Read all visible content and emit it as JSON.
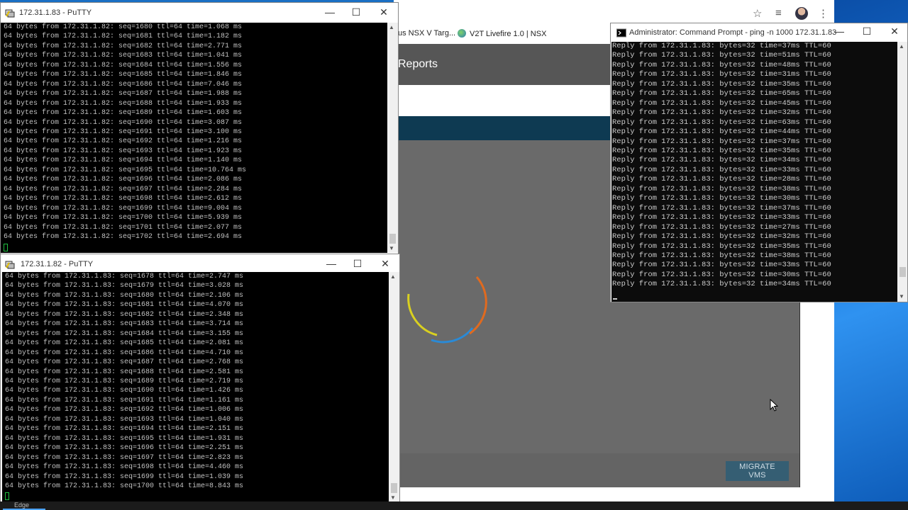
{
  "putty_top": {
    "title": "172.31.1.83 - PuTTY",
    "lines": [
      "64 bytes from 172.31.1.82: seq=1680 ttl=64 time=1.068 ms",
      "64 bytes from 172.31.1.82: seq=1681 ttl=64 time=1.182 ms",
      "64 bytes from 172.31.1.82: seq=1682 ttl=64 time=2.771 ms",
      "64 bytes from 172.31.1.82: seq=1683 ttl=64 time=1.041 ms",
      "64 bytes from 172.31.1.82: seq=1684 ttl=64 time=1.556 ms",
      "64 bytes from 172.31.1.82: seq=1685 ttl=64 time=1.846 ms",
      "64 bytes from 172.31.1.82: seq=1686 ttl=64 time=7.046 ms",
      "64 bytes from 172.31.1.82: seq=1687 ttl=64 time=1.988 ms",
      "64 bytes from 172.31.1.82: seq=1688 ttl=64 time=1.933 ms",
      "64 bytes from 172.31.1.82: seq=1689 ttl=64 time=1.603 ms",
      "64 bytes from 172.31.1.82: seq=1690 ttl=64 time=3.087 ms",
      "64 bytes from 172.31.1.82: seq=1691 ttl=64 time=3.100 ms",
      "64 bytes from 172.31.1.82: seq=1692 ttl=64 time=1.216 ms",
      "64 bytes from 172.31.1.82: seq=1693 ttl=64 time=1.923 ms",
      "64 bytes from 172.31.1.82: seq=1694 ttl=64 time=1.140 ms",
      "64 bytes from 172.31.1.82: seq=1695 ttl=64 time=10.764 ms",
      "64 bytes from 172.31.1.82: seq=1696 ttl=64 time=2.086 ms",
      "64 bytes from 172.31.1.82: seq=1697 ttl=64 time=2.284 ms",
      "64 bytes from 172.31.1.82: seq=1698 ttl=64 time=2.612 ms",
      "64 bytes from 172.31.1.82: seq=1699 ttl=64 time=9.004 ms",
      "64 bytes from 172.31.1.82: seq=1700 ttl=64 time=5.939 ms",
      "64 bytes from 172.31.1.82: seq=1701 ttl=64 time=2.077 ms",
      "64 bytes from 172.31.1.82: seq=1702 ttl=64 time=2.694 ms"
    ]
  },
  "putty_bottom": {
    "title": "172.31.1.82 - PuTTY",
    "lines": [
      "64 bytes from 172.31.1.83: seq=1678 ttl=64 time=2.747 ms",
      "64 bytes from 172.31.1.83: seq=1679 ttl=64 time=3.028 ms",
      "64 bytes from 172.31.1.83: seq=1680 ttl=64 time=2.106 ms",
      "64 bytes from 172.31.1.83: seq=1681 ttl=64 time=4.070 ms",
      "64 bytes from 172.31.1.83: seq=1682 ttl=64 time=2.348 ms",
      "64 bytes from 172.31.1.83: seq=1683 ttl=64 time=3.714 ms",
      "64 bytes from 172.31.1.83: seq=1684 ttl=64 time=3.155 ms",
      "64 bytes from 172.31.1.83: seq=1685 ttl=64 time=2.081 ms",
      "64 bytes from 172.31.1.83: seq=1686 ttl=64 time=4.710 ms",
      "64 bytes from 172.31.1.83: seq=1687 ttl=64 time=2.768 ms",
      "64 bytes from 172.31.1.83: seq=1688 ttl=64 time=2.581 ms",
      "64 bytes from 172.31.1.83: seq=1689 ttl=64 time=2.719 ms",
      "64 bytes from 172.31.1.83: seq=1690 ttl=64 time=1.426 ms",
      "64 bytes from 172.31.1.83: seq=1691 ttl=64 time=1.161 ms",
      "64 bytes from 172.31.1.83: seq=1692 ttl=64 time=1.006 ms",
      "64 bytes from 172.31.1.83: seq=1693 ttl=64 time=1.040 ms",
      "64 bytes from 172.31.1.83: seq=1694 ttl=64 time=2.151 ms",
      "64 bytes from 172.31.1.83: seq=1695 ttl=64 time=1.931 ms",
      "64 bytes from 172.31.1.83: seq=1696 ttl=64 time=2.251 ms",
      "64 bytes from 172.31.1.83: seq=1697 ttl=64 time=2.823 ms",
      "64 bytes from 172.31.1.83: seq=1698 ttl=64 time=4.460 ms",
      "64 bytes from 172.31.1.83: seq=1699 ttl=64 time=1.039 ms",
      "64 bytes from 172.31.1.83: seq=1700 ttl=64 time=8.843 ms"
    ]
  },
  "cmd": {
    "title": "Administrator: Command Prompt - ping  -n 1000 172.31.1.83",
    "lines": [
      "Reply from 172.31.1.83: bytes=32 time=37ms TTL=60",
      "Reply from 172.31.1.83: bytes=32 time=51ms TTL=60",
      "Reply from 172.31.1.83: bytes=32 time=48ms TTL=60",
      "Reply from 172.31.1.83: bytes=32 time=31ms TTL=60",
      "Reply from 172.31.1.83: bytes=32 time=35ms TTL=60",
      "Reply from 172.31.1.83: bytes=32 time=65ms TTL=60",
      "Reply from 172.31.1.83: bytes=32 time=45ms TTL=60",
      "Reply from 172.31.1.83: bytes=32 time=32ms TTL=60",
      "Reply from 172.31.1.83: bytes=32 time=63ms TTL=60",
      "Reply from 172.31.1.83: bytes=32 time=44ms TTL=60",
      "Reply from 172.31.1.83: bytes=32 time=37ms TTL=60",
      "Reply from 172.31.1.83: bytes=32 time=35ms TTL=60",
      "Reply from 172.31.1.83: bytes=32 time=34ms TTL=60",
      "Reply from 172.31.1.83: bytes=32 time=33ms TTL=60",
      "Reply from 172.31.1.83: bytes=32 time=28ms TTL=60",
      "Reply from 172.31.1.83: bytes=32 time=38ms TTL=60",
      "Reply from 172.31.1.83: bytes=32 time=30ms TTL=60",
      "Reply from 172.31.1.83: bytes=32 time=37ms TTL=60",
      "Reply from 172.31.1.83: bytes=32 time=33ms TTL=60",
      "Reply from 172.31.1.83: bytes=32 time=27ms TTL=60",
      "Reply from 172.31.1.83: bytes=32 time=32ms TTL=60",
      "Reply from 172.31.1.83: bytes=32 time=35ms TTL=60",
      "Reply from 172.31.1.83: bytes=32 time=38ms TTL=60",
      "Reply from 172.31.1.83: bytes=32 time=33ms TTL=60",
      "Reply from 172.31.1.83: bytes=32 time=30ms TTL=60",
      "Reply from 172.31.1.83: bytes=32 time=34ms TTL=60"
    ]
  },
  "browser": {
    "bookmark_1": "us NSX V Targ...",
    "bookmark_2": "V2T Livefire 1.0 | NSX",
    "header_title": "Reports",
    "migrate_button": "MIGRATE VMS"
  },
  "taskbar": {
    "app_label": "Edge"
  },
  "colors": {
    "app_header": "#565656",
    "app_navy": "#0e3a52",
    "app_content": "#6a6a6a",
    "migrate_button": "#355e73",
    "spinner_yellow": "#d9d020",
    "spinner_orange": "#e06a1f",
    "spinner_blue": "#2a8ad6"
  }
}
